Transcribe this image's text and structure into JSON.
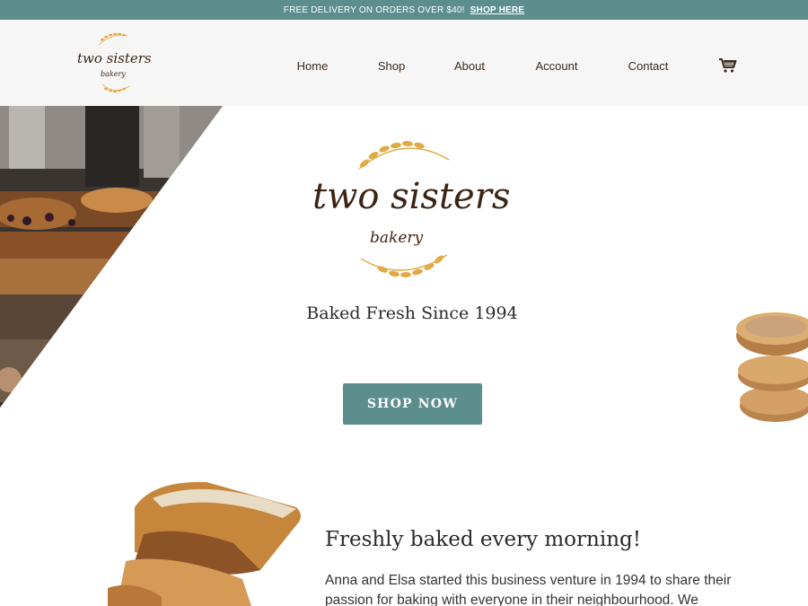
{
  "announcement": {
    "text": "FREE DELIVERY ON ORDERS OVER $40!",
    "link": "SHOP HERE"
  },
  "header": {
    "logo_icon": "two-sisters-bakery-logo",
    "nav": [
      "Home",
      "Shop",
      "About",
      "Account",
      "Contact"
    ],
    "cart_icon": "cart-icon"
  },
  "hero": {
    "tagline": "Baked Fresh Since 1994",
    "cta": "SHOP NOW"
  },
  "about": {
    "title": "Freshly baked every morning!",
    "text": "Anna and Elsa started this business venture in 1994 to share their passion for baking with everyone in their neighbourhood. We"
  },
  "colors": {
    "accent": "#5c8e8e",
    "brand_brown": "#3b2414",
    "wheat_gold": "#e2aa45",
    "header_bg": "#f6f6f6"
  }
}
